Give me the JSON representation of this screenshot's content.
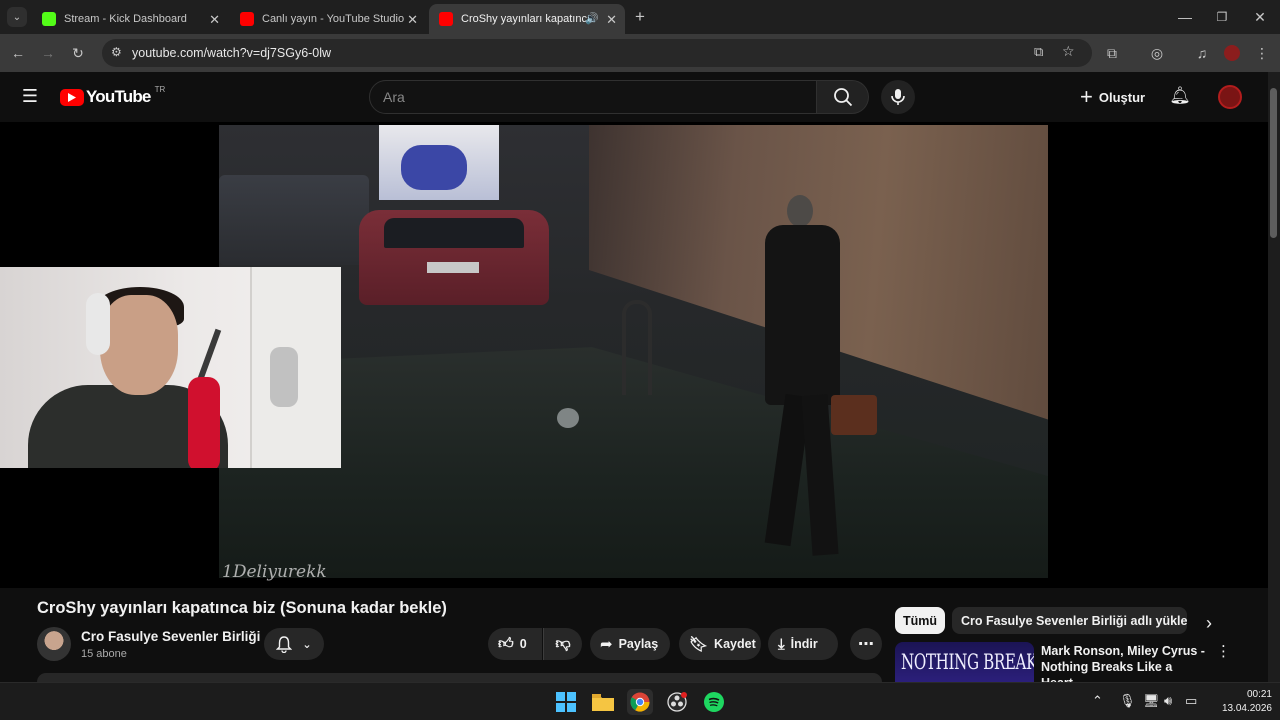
{
  "browser": {
    "tabs": [
      {
        "title": "Stream - Kick Dashboard",
        "favicon_color": "#53fc18",
        "active": false
      },
      {
        "title": "Canlı yayın - YouTube Studio",
        "favicon_color": "#ff0000",
        "active": false
      },
      {
        "title": "CroShy yayınları kapatınca b",
        "favicon_color": "#ff0000",
        "active": true
      }
    ],
    "url": "youtube.com/watch?v=dj7SGy6-0lw"
  },
  "youtube": {
    "logo_text": "YouTube",
    "region": "TR",
    "search_placeholder": "Ara",
    "create_label": "Oluştur"
  },
  "video": {
    "watermark": "1Deliyurekk",
    "title": "CroShy yayınları kapatınca biz (Sonuna kadar bekle)",
    "channel_name": "Cro Fasulye Sevenler Birliği",
    "subscribers": "15 abone",
    "like_count": "0",
    "share_label": "Paylaş",
    "save_label": "Kaydet",
    "download_label": "İndir"
  },
  "sidebar": {
    "chips": [
      "Tümü",
      "Cro Fasulye Sevenler Birliği adlı yükleyiciden"
    ],
    "recommendation": {
      "thumbnail_text": "NOTHING BREAKS",
      "title": "Mark Ronson, Miley Cyrus - Nothing Breaks Like a Heart ..."
    }
  },
  "taskbar": {
    "time": "00:21",
    "date": "13.04.2026"
  },
  "colors": {
    "accent_red": "#ff0000",
    "background": "#0f0f0f"
  }
}
